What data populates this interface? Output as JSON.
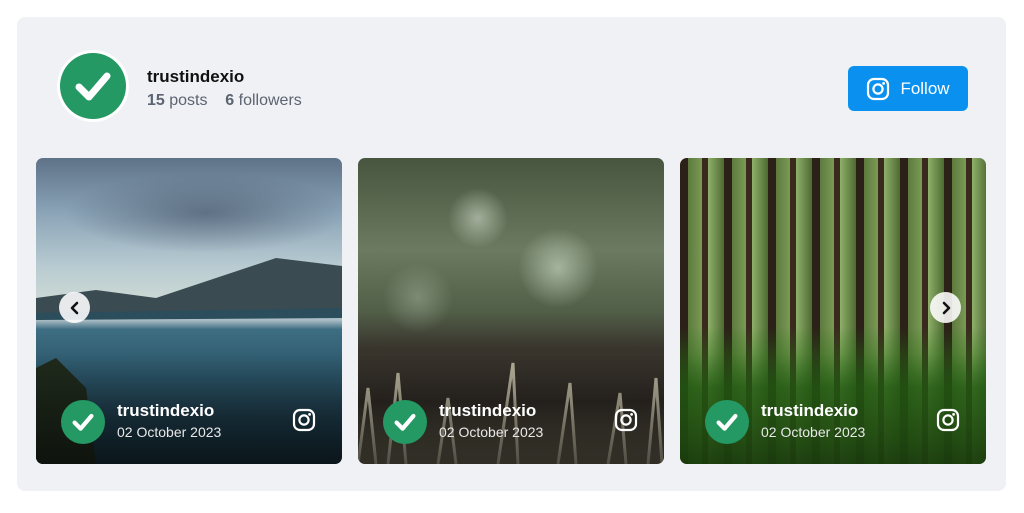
{
  "profile": {
    "username": "trustindexio",
    "posts_count": "15",
    "posts_label": "posts",
    "followers_count": "6",
    "followers_label": "followers",
    "follow_label": "Follow"
  },
  "icons": {
    "avatar": "check-icon",
    "follow": "instagram-icon",
    "prev": "chevron-left-icon",
    "next": "chevron-right-icon"
  },
  "colors": {
    "brand_green": "#259963",
    "follow_blue": "#0a91ef",
    "widget_bg": "#eff1f5"
  },
  "posts": [
    {
      "username": "trustindexio",
      "date": "02 October 2023",
      "image": "lake-mountains-photo"
    },
    {
      "username": "trustindexio",
      "date": "02 October 2023",
      "image": "grass-bokeh-photo"
    },
    {
      "username": "trustindexio",
      "date": "02 October 2023",
      "image": "forest-photo"
    }
  ]
}
